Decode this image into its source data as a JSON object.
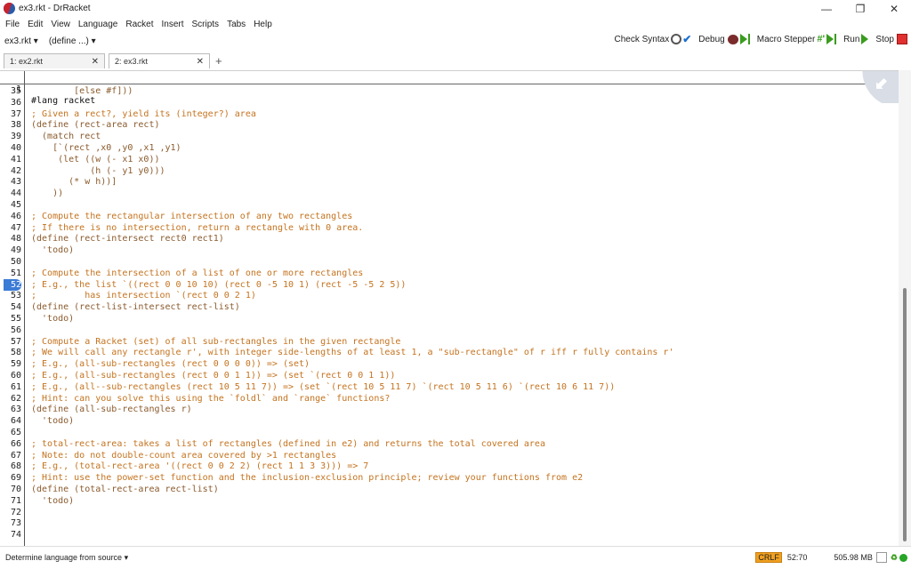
{
  "window": {
    "title": "ex3.rkt - DrRacket",
    "minimize": "—",
    "maximize": "❐",
    "close": "✕"
  },
  "menu": [
    "File",
    "Edit",
    "View",
    "Language",
    "Racket",
    "Insert",
    "Scripts",
    "Tabs",
    "Help"
  ],
  "toolbar": {
    "file_drop": "ex3.rkt ▾",
    "define_drop": "(define ...) ▾",
    "check_syntax": "Check Syntax",
    "debug": "Debug",
    "macro_stepper": "Macro Stepper",
    "run": "Run",
    "stop": "Stop"
  },
  "tabs": [
    {
      "label": "1: ex2.rkt",
      "close": "✕"
    },
    {
      "label": "2: ex3.rkt",
      "close": "✕"
    }
  ],
  "tab_add": "+",
  "editor": {
    "first_line": {
      "num": "1",
      "text": "#lang racket"
    },
    "highlighted_line": "52",
    "lines": [
      {
        "num": "35",
        "text": "        [else #f]))"
      },
      {
        "num": "36",
        "text": ""
      },
      {
        "num": "37",
        "text": "; Given a rect?, yield its (integer?) area"
      },
      {
        "num": "38",
        "text": "(define (rect-area rect)"
      },
      {
        "num": "39",
        "text": "  (match rect"
      },
      {
        "num": "40",
        "text": "    [`(rect ,x0 ,y0 ,x1 ,y1)"
      },
      {
        "num": "41",
        "text": "     (let ((w (- x1 x0))"
      },
      {
        "num": "42",
        "text": "           (h (- y1 y0)))"
      },
      {
        "num": "43",
        "text": "       (* w h))]"
      },
      {
        "num": "44",
        "text": "    ))"
      },
      {
        "num": "45",
        "text": ""
      },
      {
        "num": "46",
        "text": "; Compute the rectangular intersection of any two rectangles"
      },
      {
        "num": "47",
        "text": "; If there is no intersection, return a rectangle with 0 area."
      },
      {
        "num": "48",
        "text": "(define (rect-intersect rect0 rect1)"
      },
      {
        "num": "49",
        "text": "  'todo)"
      },
      {
        "num": "50",
        "text": ""
      },
      {
        "num": "51",
        "text": "; Compute the intersection of a list of one or more rectangles"
      },
      {
        "num": "52",
        "text": "; E.g., the list `((rect 0 0 10 10) (rect 0 -5 10 1) (rect -5 -5 2 5))"
      },
      {
        "num": "53",
        "text": ";         has intersection `(rect 0 0 2 1)"
      },
      {
        "num": "54",
        "text": "(define (rect-list-intersect rect-list)"
      },
      {
        "num": "55",
        "text": "  'todo)"
      },
      {
        "num": "56",
        "text": ""
      },
      {
        "num": "57",
        "text": "; Compute a Racket (set) of all sub-rectangles in the given rectangle"
      },
      {
        "num": "58",
        "text": "; We will call any rectangle r', with integer side-lengths of at least 1, a \"sub-rectangle\" of r iff r fully contains r'"
      },
      {
        "num": "59",
        "text": "; E.g., (all-sub-rectangles (rect 0 0 0 0)) => (set)"
      },
      {
        "num": "60",
        "text": "; E.g., (all-sub-rectangles (rect 0 0 1 1)) => (set `(rect 0 0 1 1))"
      },
      {
        "num": "61",
        "text": "; E.g., (all--sub-rectangles (rect 10 5 11 7)) => (set `(rect 10 5 11 7) `(rect 10 5 11 6) `(rect 10 6 11 7))"
      },
      {
        "num": "62",
        "text": "; Hint: can you solve this using the `foldl` and `range` functions?"
      },
      {
        "num": "63",
        "text": "(define (all-sub-rectangles r)"
      },
      {
        "num": "64",
        "text": "  'todo)"
      },
      {
        "num": "65",
        "text": ""
      },
      {
        "num": "66",
        "text": "; total-rect-area: takes a list of rectangles (defined in e2) and returns the total covered area"
      },
      {
        "num": "67",
        "text": "; Note: do not double-count area covered by >1 rectangles"
      },
      {
        "num": "68",
        "text": "; E.g., (total-rect-area '((rect 0 0 2 2) (rect 1 1 3 3))) => 7"
      },
      {
        "num": "69",
        "text": "; Hint: use the power-set function and the inclusion-exclusion principle; review your functions from e2"
      },
      {
        "num": "70",
        "text": "(define (total-rect-area rect-list)"
      },
      {
        "num": "71",
        "text": "  'todo)"
      },
      {
        "num": "72",
        "text": ""
      },
      {
        "num": "73",
        "text": ""
      },
      {
        "num": "74",
        "text": ""
      }
    ]
  },
  "status": {
    "language": "Determine language from source ▾",
    "eol": "CRLF",
    "position": "52:70",
    "memory": "505.98 MB"
  },
  "colors": {
    "comment": "#c4731f",
    "code": "#8a5a2c",
    "line_highlight": "#3a7bd5",
    "run": "#3a9c1e",
    "stop": "#e03030"
  }
}
